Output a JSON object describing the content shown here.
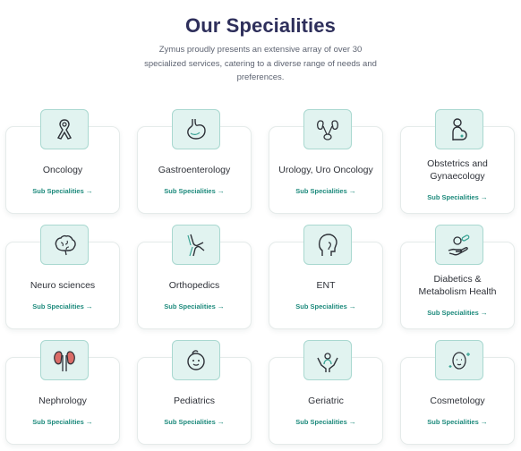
{
  "header": {
    "title": "Our Specialities",
    "subtitle": "Zymus proudly presents an extensive array of over 30 specialized services, catering to a diverse range of needs and preferences."
  },
  "link_label": "Sub Specialities",
  "link_arrow": "→",
  "colors": {
    "accent": "#1d8a7c",
    "title": "#2e2f5b",
    "icon_bg": "#e1f3f0",
    "icon_border": "#a9d8d0"
  },
  "specialities": [
    {
      "name": "Oncology",
      "icon": "ribbon-icon"
    },
    {
      "name": "Gastroenterology",
      "icon": "stomach-icon"
    },
    {
      "name": "Urology, Uro Oncology",
      "icon": "kidney-bladder-icon"
    },
    {
      "name": "Obstetrics and Gynaecology",
      "icon": "pregnant-woman-icon"
    },
    {
      "name": "Neuro sciences",
      "icon": "brain-icon"
    },
    {
      "name": "Orthopedics",
      "icon": "knee-joint-icon"
    },
    {
      "name": "ENT",
      "icon": "head-ear-icon"
    },
    {
      "name": "Diabetics & Metabolism Health",
      "icon": "hand-pills-icon"
    },
    {
      "name": "Nephrology",
      "icon": "kidneys-icon"
    },
    {
      "name": "Pediatrics",
      "icon": "baby-icon"
    },
    {
      "name": "Geriatric",
      "icon": "hands-care-icon"
    },
    {
      "name": "Cosmetology",
      "icon": "face-sparkle-icon"
    }
  ]
}
